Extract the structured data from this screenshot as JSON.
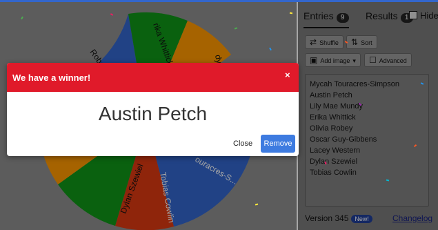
{
  "colors": {
    "wheel_blue": "#3366cc",
    "wheel_green": "#109618",
    "wheel_yellow": "#ff9900",
    "wheel_red": "#dc3912",
    "winner_header": "#e01a2a",
    "remove_button": "#3d7be0"
  },
  "wheel": {
    "visible_labels": [
      "Olivia Robey",
      "Erika Whittick",
      "Lily Mae Mundy",
      "Mycah Touracres-Simpson",
      "Tobias Cowlin",
      "Dylan Szewiel"
    ],
    "visible_label_text": [
      "Robey",
      "rika Whittick",
      "dy",
      "ouracres-S...",
      "Tobias Cowlin",
      "Dylan Szewiel"
    ]
  },
  "tabs": {
    "entries_label": "Entries",
    "entries_count": "9",
    "results_label": "Results",
    "results_count": "1",
    "hide_label": "Hide"
  },
  "toolbar": {
    "shuffle_label": "Shuffle",
    "sort_label": "Sort",
    "add_image_label": "Add image",
    "advanced_label": "Advanced"
  },
  "entries": [
    "Mycah Touracres-Simpson",
    "Austin Petch",
    "Lily Mae Mundy",
    "Erika Whittick",
    "Olivia Robey",
    "Oscar Guy-Gibbens",
    "Lacey Western",
    "Dylan Szewiel",
    "Tobias Cowlin"
  ],
  "footer": {
    "version_label": "Version 345",
    "new_badge": "New!",
    "changelog_label": "Changelog"
  },
  "modal": {
    "title": "We have a winner!",
    "close_x": "×",
    "winner_name": "Austin Petch",
    "close_label": "Close",
    "remove_label": "Remove"
  }
}
